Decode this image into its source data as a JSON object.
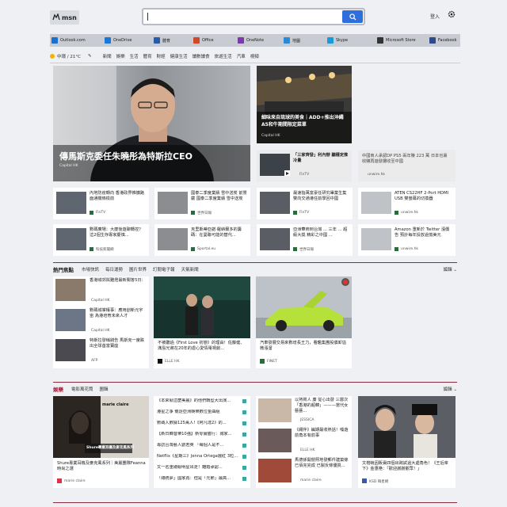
{
  "header": {
    "logo_text": "msn",
    "search_placeholder": "",
    "login_label": "登入"
  },
  "apps": [
    {
      "label": "Outlook.com",
      "color": "#1a6fd1"
    },
    {
      "label": "OneDrive",
      "color": "#1a78d4"
    },
    {
      "label": "體育",
      "color": "#2a5aa8"
    },
    {
      "label": "Office",
      "color": "#d24726"
    },
    {
      "label": "OneNote",
      "color": "#7a3aa8"
    },
    {
      "label": "地圖",
      "color": "#2a8ad4"
    },
    {
      "label": "Skype",
      "color": "#1a9ad8"
    },
    {
      "label": "Microsoft Store",
      "color": "#333333"
    },
    {
      "label": "Facebook",
      "color": "#2d4a8a"
    }
  ],
  "weather": {
    "location_temp": "中環 / 21°C"
  },
  "nav_items": [
    "新聞",
    "娛樂",
    "生活",
    "體育",
    "財經",
    "健康生活",
    "讀數讀食",
    "旅遊生活",
    "汽車",
    "視頻"
  ],
  "hero": {
    "title": "傳馬斯克委任朱曉彤為特斯拉CEO",
    "source": "Capital HK"
  },
  "top_right": {
    "title": "細味來自琉球的美食｜ADD+推出沖繩A5和牛期間限定菜單",
    "source": "Capital HK"
  },
  "row1": [
    {
      "title": "「三家齊發」利內辦 聽穩定推冷量",
      "source": "FinTV"
    },
    {
      "title": "中國商人承認DP PS5 兩年賺 223 萬 日本也賣收購再遊發攤收至中國",
      "source": "unwire.hk"
    }
  ],
  "row2": [
    {
      "title": "內地防疫轉向 香港政界推擴路面通關條檢前",
      "source": "FinTV"
    },
    {
      "title": "國泰二季度業績 雪中送炭 前景嚴 國泰二季度業績 雪中送炭",
      "source": "世界日報"
    },
    {
      "title": "最速指萬富豪任研究畢業生集 雙向交通港任前學回中國",
      "source": "FinTV"
    },
    {
      "title": "ATEN CS22HF 2-Port HDMI USB 雙螢幕的切換器",
      "source": "unwire.hk"
    }
  ],
  "row3": [
    {
      "title": "數碼廣場：大廈後遊聊轉控？這2個生存專家慶慎...",
      "source": "科技新聞網"
    },
    {
      "title": "克里斯蒂亞諾·羅納爾多的籌碼：在曼聯可能的替代...",
      "source": "Sportal.eu"
    },
    {
      "title": "亞洲華商到台灣 ... 三年 ... 超級大獎 精彩之中國 ...",
      "source": "世界日報"
    },
    {
      "title": "Amazon 重新於 Twitter 漲價告 預計每年投放過億美元",
      "source": "unwire.hk"
    }
  ],
  "hot_section": {
    "title": "熱門焦點",
    "tabs": [
      "市場快訊",
      "每日運勢",
      "圖片世界",
      "訂閱電子報",
      "天氣新聞"
    ],
    "edit_label": "編輯"
  },
  "hot_list": [
    {
      "title": "香港城郊與難燈最新闖答5日：",
      "source": "Capital HK"
    },
    {
      "title": "數碼城掌權事：應用創新元宇宙 為港培育未來人才",
      "source": "Capital HK"
    },
    {
      "title": "特斯拉發稱錢告 馬斯克一度跌出全球首富寶座",
      "source": "AFP"
    }
  ],
  "hot_cards": [
    {
      "title": "不被聽過《First Love 初戀》的理由！佐藤健、滿島光將在20年的虐心愛情電視劇...",
      "source": "ELLE HK"
    },
    {
      "title": "汽車發展交易來數增長王力，看鑑集團股價卸溢微漲溜",
      "source": "FINET"
    }
  ],
  "ent_section": {
    "title": "娛樂",
    "tabs": [
      "電影萬花筒",
      "圖輯"
    ],
    "edit_label": "編輯"
  },
  "ent_feature": {
    "brand": "marie claire",
    "overlay": "Shure專業耳機及麥克風系列",
    "title": "Shure專業耳機及麥克風系列｜美麗團隊Feanna時尚之選",
    "source": "marie claire"
  },
  "ent_list": [
    "《本來就這麼美麗》的他們轉型大出演...",
    "港星之争 競逐亞洲娛樂數位金曲組",
    "數碼入數據125萬人!《阿凡達2》的...",
    "【新日韓音樂10強】新零實體行：城家...",
    "專訪台灣藝人劉若英 「每個人是不...",
    "Netflix《星期三》Jenna Ortega展紅 3粒...",
    "又一名重磅級明星出走！離婚承認...",
    "「總統夢」國家再：但是「元節」最高..."
  ],
  "ent_mid": [
    {
      "title": "以熱鬧人 廉 從心出發 三層次「香港的超韓」———當代女藝藝...",
      "source": "JESSICA"
    },
    {
      "title": "《繩伴》編期最收熱話！嗓遊前角本有前事",
      "source": "ELLE HK"
    },
    {
      "title": "馬德孫開營熙地發郵件建築條 已佰完完成 已製反條優質...",
      "source": "marie claire"
    }
  ],
  "ent_right": {
    "title": "文榕蛻因販賣四個出跨試過大處角色！《王后傘下》金惠艳：「歡迎謝謝觀眾！」",
    "source": "KSD 韓星網"
  }
}
